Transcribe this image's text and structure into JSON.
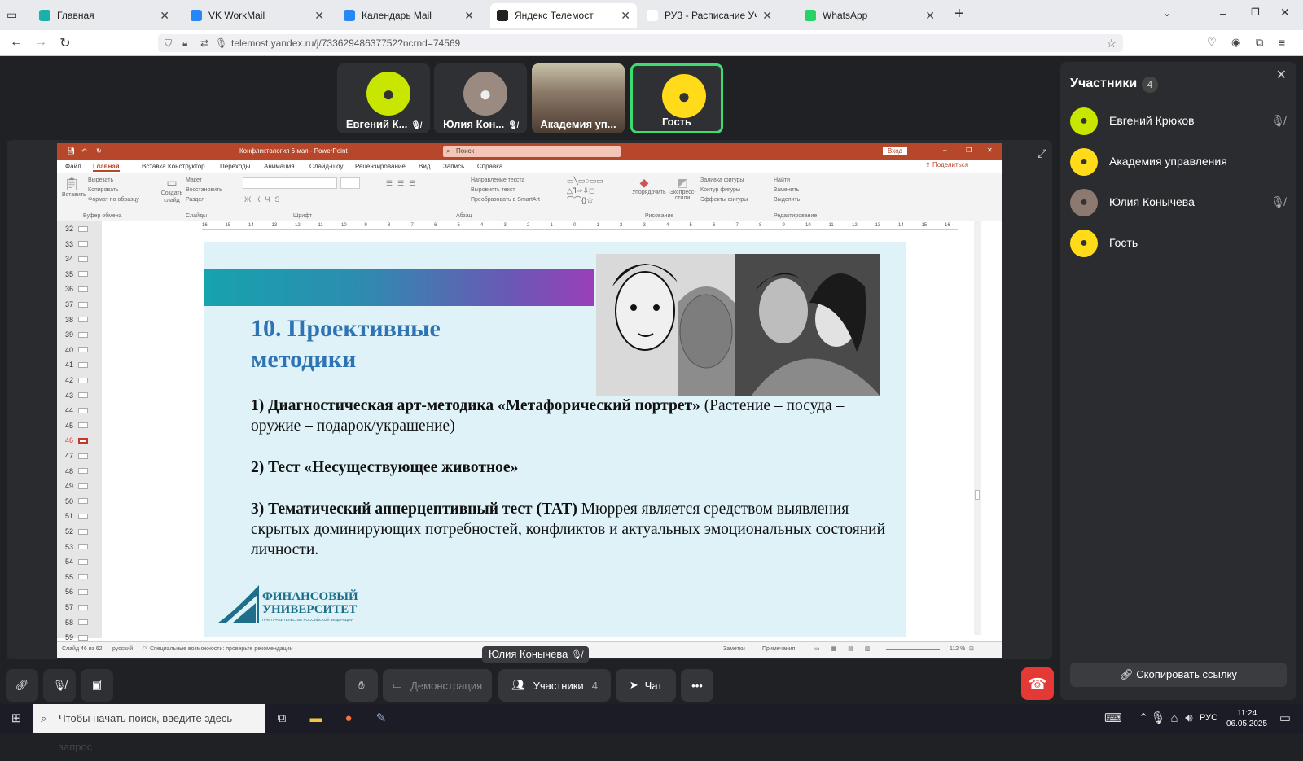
{
  "browser": {
    "tabs": [
      {
        "label": "Главная",
        "color": "#1ab2a8"
      },
      {
        "label": "VK WorkMail",
        "color": "#2787f5"
      },
      {
        "label": "Календарь Mail",
        "color": "#2787f5"
      },
      {
        "label": "Яндекс Телемост",
        "color": "#222222",
        "active": true
      },
      {
        "label": "РУЗ - Расписание Учебных Заняти",
        "color": "#ffffff"
      },
      {
        "label": "WhatsApp",
        "color": "#25d366"
      }
    ],
    "url": "telemost.yandex.ru/j/73362948637752?ncrnd=74569"
  },
  "tiles": [
    {
      "name": "Евгений К...",
      "muted": true
    },
    {
      "name": "Юлия Кон...",
      "muted": true
    },
    {
      "name": "Академия уп...",
      "muted": false
    },
    {
      "name": "Гость",
      "muted": false,
      "selected": true
    }
  ],
  "powerpoint": {
    "title": "Конфликтология 6 мая - PowerPoint",
    "search": "Поиск",
    "login": "Вход",
    "share": "Поделиться",
    "ribbon_tabs": [
      "Файл",
      "Главная",
      "Вставка",
      "Конструктор",
      "Переходы",
      "Анимация",
      "Слайд-шоу",
      "Рецензирование",
      "Вид",
      "Запись",
      "Справка"
    ],
    "groups": [
      "Буфер обмена",
      "Слайды",
      "Шрифт",
      "Абзац",
      "Рисование",
      "Редактирование"
    ],
    "clipboard": [
      "Вырезать",
      "Копировать",
      "Формат по образцу"
    ],
    "paste": "Вставить",
    "slides_btns": [
      "Макет",
      "Восстановить",
      "Раздел"
    ],
    "create_slide": "Создать слайд",
    "para": [
      "Направление текста",
      "Выровнять текст",
      "Преобразовать в SmartArt"
    ],
    "arrange": "Упорядочить",
    "express": "Экспресс-стили",
    "fill": [
      "Заливка фигуры",
      "Контур фигуры",
      "Эффекты фигуры"
    ],
    "edit": [
      "Найти",
      "Заменить",
      "Выделить"
    ],
    "slide_numbers": [
      "32",
      "33",
      "34",
      "35",
      "36",
      "37",
      "38",
      "39",
      "40",
      "41",
      "42",
      "43",
      "44",
      "45",
      "46",
      "47",
      "48",
      "49",
      "50",
      "51",
      "52",
      "53",
      "54",
      "55",
      "56",
      "57",
      "58",
      "59"
    ],
    "current_slide": "46",
    "ruler": [
      "16",
      "15",
      "14",
      "13",
      "12",
      "11",
      "10",
      "9",
      "8",
      "7",
      "6",
      "5",
      "4",
      "3",
      "2",
      "1",
      "0",
      "1",
      "2",
      "3",
      "4",
      "5",
      "6",
      "7",
      "8",
      "9",
      "10",
      "11",
      "12",
      "13",
      "14",
      "15",
      "16"
    ],
    "status": {
      "slide": "Слайд 46 из 62",
      "lang": "русский",
      "access": "Специальные возможности: проверьте рекомендации",
      "notes": "Заметки",
      "comments": "Примечания",
      "zoom": "112 %"
    }
  },
  "slide": {
    "title": "10. Проективные методики",
    "p1_bold": "1)   Диагностическая арт-методика «Метафорический портрет»",
    "p1_rest": " (Растение – посуда – оружие – подарок/украшение)",
    "p2_bold": "2) Тест «Несуществующее животное»",
    "p3_bold": "3) Тематический апперцептивный тест (ТАТ)",
    "p3_rest": " Мюррея является средством выявления скрытых доминирующих потребностей, конфликтов и актуальных эмоциональных состояний личности.",
    "logo_line1": "ФИНАНСОВЫЙ",
    "logo_line2": "УНИВЕРСИТЕТ",
    "logo_line3": "ПРИ ПРАВИТЕЛЬСТВЕ РОССИЙСКОЙ ФЕДЕРАЦИИ"
  },
  "speaker": "Юлия Конычева",
  "participants": {
    "title": "Участники",
    "count": "4",
    "list": [
      {
        "name": "Евгений Крюков",
        "muted": true,
        "type": "g"
      },
      {
        "name": "Академия управления",
        "muted": false,
        "type": "y"
      },
      {
        "name": "Юлия Конычева",
        "muted": true,
        "type": "ph"
      },
      {
        "name": "Гость",
        "muted": false,
        "type": "y"
      }
    ],
    "copy_link": "Скопировать ссылку"
  },
  "controls": {
    "demo": "Демонстрация",
    "participants": "Участники",
    "participants_count": "4",
    "chat": "Чат"
  },
  "taskbar": {
    "search": "Чтобы начать поиск, введите здесь запрос",
    "lang": "РУС",
    "time": "11:24",
    "date": "06.05.2025"
  }
}
